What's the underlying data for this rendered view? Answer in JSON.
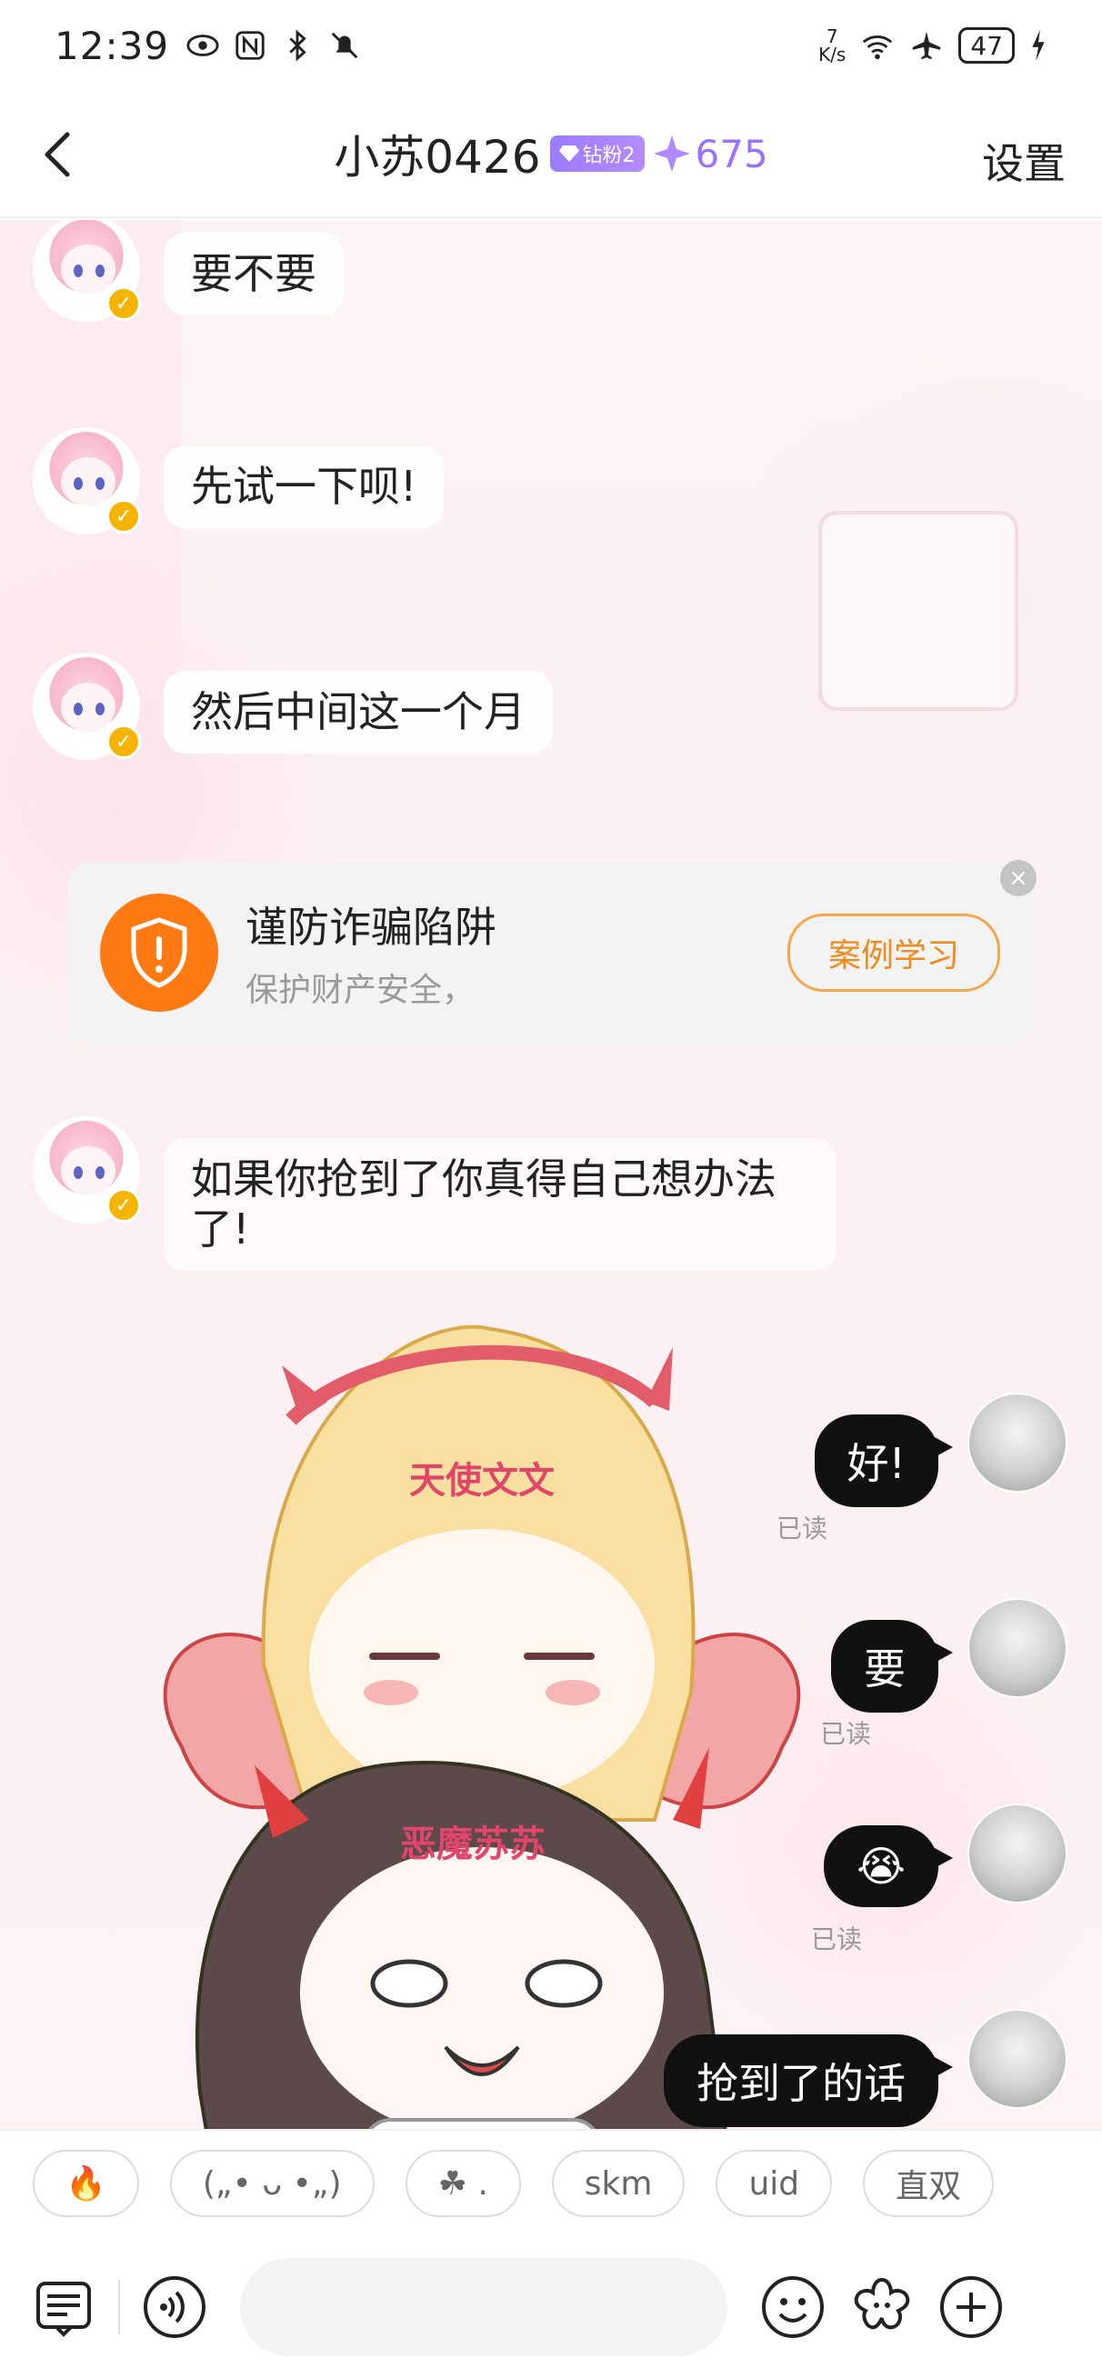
{
  "status_bar": {
    "time": "12:39",
    "speed_value": "7",
    "speed_unit": "K/s",
    "battery": "47"
  },
  "header": {
    "title": "小苏0426",
    "fan_badge": "钻粉2",
    "points": "675",
    "settings_label": "设置"
  },
  "messages_left": [
    {
      "text": "要不要"
    },
    {
      "text": "先试一下呗!"
    },
    {
      "text": "然后中间这一个月"
    },
    {
      "text": "如果你抢到了你真得自己想办法了!"
    }
  ],
  "warning": {
    "title": "谨防诈骗陷阱",
    "subtitle": "保护财产安全，",
    "button": "案例学习",
    "close": "×"
  },
  "sticker": {
    "text_top": "天使文文",
    "text_bottom": "恶魔苏苏"
  },
  "messages_right": [
    {
      "text": "好!",
      "status": "已读"
    },
    {
      "text": "要",
      "status": "已读"
    },
    {
      "text": "😭",
      "status": "已读"
    },
    {
      "text": "抢到了的话",
      "status": ""
    }
  ],
  "quick_replies": [
    "🔥",
    "(„• ᴗ •„)",
    "☘ .",
    "skm",
    "uid",
    "直双"
  ],
  "input": {
    "placeholder": ""
  },
  "icons": {
    "back": "chevron-left-icon",
    "menu": "list-icon",
    "voice": "voice-icon",
    "emoji": "emoji-icon",
    "sticker": "flower-icon",
    "add": "plus-icon"
  },
  "colors": {
    "accent_orange": "#ff7a12",
    "fan_badge": "#9b7bff",
    "dark_bubble": "#111111"
  }
}
